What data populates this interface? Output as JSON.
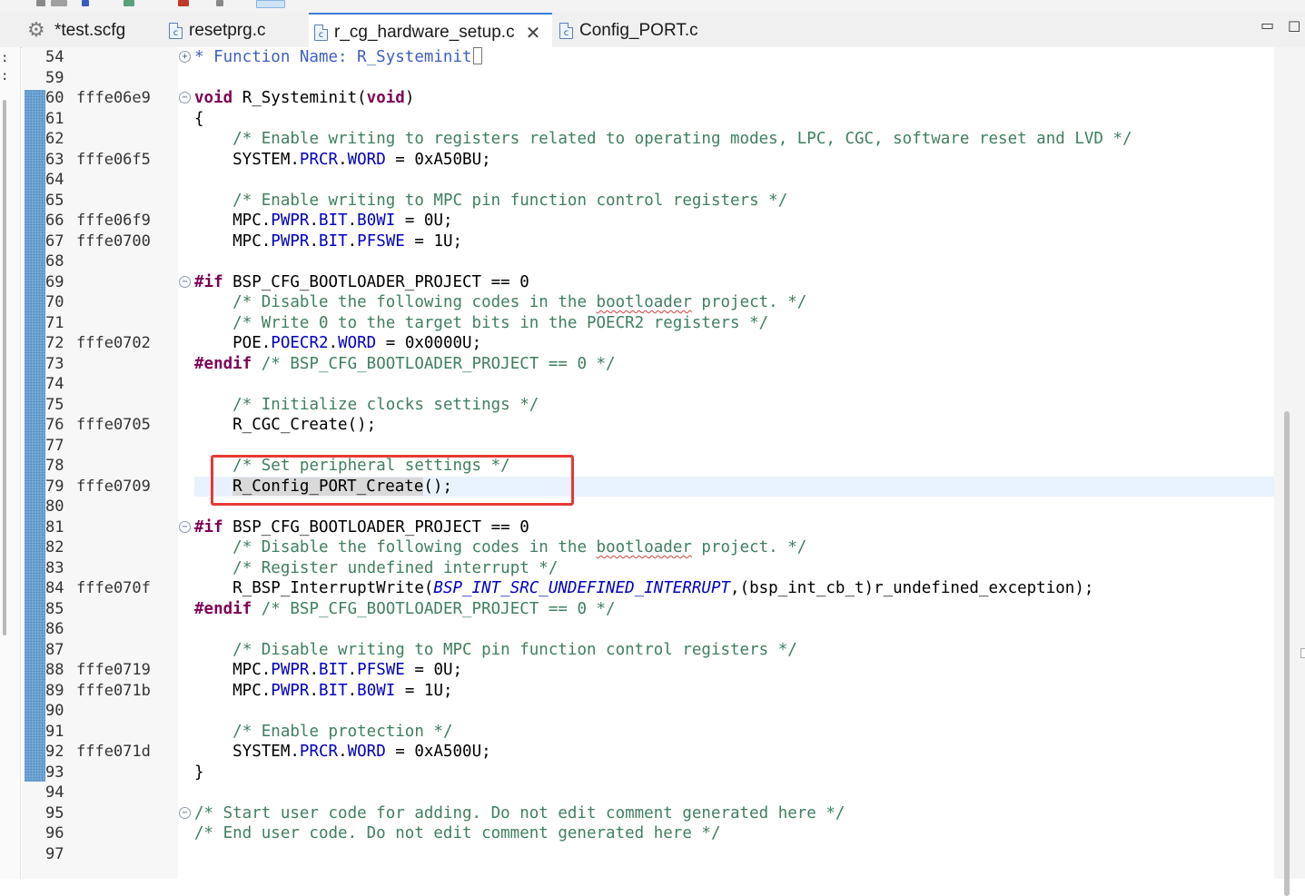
{
  "tabs": [
    {
      "label": "*test.scfg",
      "icon": "gear-icon",
      "active": false
    },
    {
      "label": "resetprg.c",
      "icon": "c-file-icon",
      "active": false
    },
    {
      "label": "r_cg_hardware_setup.c",
      "icon": "c-file-icon",
      "active": true,
      "close": "✕"
    },
    {
      "label": "Config_PORT.c",
      "icon": "c-file-icon",
      "active": false
    }
  ],
  "window_buttons": {
    "minimize": "▭",
    "maximize": "☐"
  },
  "file_icon_letter": "c",
  "colors": {
    "comment": "#3f7f5f",
    "keyword": "#7f0055",
    "field": "#0000c0",
    "current_line": "#e8f2fe",
    "annotation_box": "#e53935",
    "change_bar": "#7fb0dc"
  },
  "lines": [
    {
      "num": "54",
      "addr": "",
      "fold": "+",
      "code": [
        [
          "doc",
          "* Function Name: R_Systeminit"
        ],
        [
          "box",
          ""
        ]
      ]
    },
    {
      "num": "59",
      "addr": "",
      "code": []
    },
    {
      "num": "60",
      "addr": "fffe06e9",
      "fold": "−",
      "code": [
        [
          "kw",
          "void"
        ],
        [
          "plain",
          " R_Systeminit("
        ],
        [
          "kw",
          "void"
        ],
        [
          "plain",
          ")"
        ]
      ]
    },
    {
      "num": "61",
      "addr": "",
      "code": [
        [
          "plain",
          "{"
        ]
      ]
    },
    {
      "num": "62",
      "addr": "",
      "code": [
        [
          "plain",
          "    "
        ],
        [
          "cmt",
          "/* Enable writing to registers related to operating modes, LPC, CGC, software reset and LVD */"
        ]
      ]
    },
    {
      "num": "63",
      "addr": "fffe06f5",
      "code": [
        [
          "plain",
          "    SYSTEM."
        ],
        [
          "fld",
          "PRCR"
        ],
        [
          "plain",
          "."
        ],
        [
          "fld",
          "WORD"
        ],
        [
          "plain",
          " = 0xA50BU;"
        ]
      ]
    },
    {
      "num": "64",
      "addr": "",
      "code": []
    },
    {
      "num": "65",
      "addr": "",
      "code": [
        [
          "plain",
          "    "
        ],
        [
          "cmt",
          "/* Enable writing to MPC pin function control registers */"
        ]
      ]
    },
    {
      "num": "66",
      "addr": "fffe06f9",
      "code": [
        [
          "plain",
          "    MPC."
        ],
        [
          "fld",
          "PWPR"
        ],
        [
          "plain",
          "."
        ],
        [
          "fld",
          "BIT"
        ],
        [
          "plain",
          "."
        ],
        [
          "fld",
          "B0WI"
        ],
        [
          "plain",
          " = 0U;"
        ]
      ]
    },
    {
      "num": "67",
      "addr": "fffe0700",
      "code": [
        [
          "plain",
          "    MPC."
        ],
        [
          "fld",
          "PWPR"
        ],
        [
          "plain",
          "."
        ],
        [
          "fld",
          "BIT"
        ],
        [
          "plain",
          "."
        ],
        [
          "fld",
          "PFSWE"
        ],
        [
          "plain",
          " = 1U;"
        ]
      ]
    },
    {
      "num": "68",
      "addr": "",
      "code": []
    },
    {
      "num": "69",
      "addr": "",
      "fold": "−",
      "code": [
        [
          "pp",
          "#if"
        ],
        [
          "plain",
          " BSP_CFG_BOOTLOADER_PROJECT == 0"
        ]
      ]
    },
    {
      "num": "70",
      "addr": "",
      "code": [
        [
          "plain",
          "    "
        ],
        [
          "cmt",
          "/* Disable the following codes in the "
        ],
        [
          "cmtsq",
          "bootloader"
        ],
        [
          "cmt",
          " project. */"
        ]
      ]
    },
    {
      "num": "71",
      "addr": "",
      "code": [
        [
          "plain",
          "    "
        ],
        [
          "cmt",
          "/* Write 0 to the target bits in the POECR2 registers */"
        ]
      ]
    },
    {
      "num": "72",
      "addr": "fffe0702",
      "code": [
        [
          "plain",
          "    POE."
        ],
        [
          "fld",
          "POECR2"
        ],
        [
          "plain",
          "."
        ],
        [
          "fld",
          "WORD"
        ],
        [
          "plain",
          " = 0x0000U;"
        ]
      ]
    },
    {
      "num": "73",
      "addr": "",
      "code": [
        [
          "pp",
          "#endif"
        ],
        [
          "plain",
          " "
        ],
        [
          "cmt",
          "/* BSP_CFG_BOOTLOADER_PROJECT == 0 */"
        ]
      ]
    },
    {
      "num": "74",
      "addr": "",
      "code": []
    },
    {
      "num": "75",
      "addr": "",
      "code": [
        [
          "plain",
          "    "
        ],
        [
          "cmt",
          "/* Initialize clocks settings */"
        ]
      ]
    },
    {
      "num": "76",
      "addr": "fffe0705",
      "code": [
        [
          "plain",
          "    R_CGC_Create();"
        ]
      ]
    },
    {
      "num": "77",
      "addr": "",
      "code": []
    },
    {
      "num": "78",
      "addr": "",
      "code": [
        [
          "plain",
          "    "
        ],
        [
          "cmt",
          "/* Set peripheral settings */"
        ]
      ]
    },
    {
      "num": "79",
      "addr": "fffe0709",
      "current": true,
      "code": [
        [
          "plain",
          "    "
        ],
        [
          "sel",
          "R_Config_POR"
        ],
        [
          "caret",
          ""
        ],
        [
          "sel",
          "T_Create"
        ],
        [
          "plain",
          "();"
        ]
      ]
    },
    {
      "num": "80",
      "addr": "",
      "code": []
    },
    {
      "num": "81",
      "addr": "",
      "fold": "−",
      "code": [
        [
          "pp",
          "#if"
        ],
        [
          "plain",
          " BSP_CFG_BOOTLOADER_PROJECT == 0"
        ]
      ]
    },
    {
      "num": "82",
      "addr": "",
      "code": [
        [
          "plain",
          "    "
        ],
        [
          "cmt",
          "/* Disable the following codes in the "
        ],
        [
          "cmtsq",
          "bootloader"
        ],
        [
          "cmt",
          " project. */"
        ]
      ]
    },
    {
      "num": "83",
      "addr": "",
      "code": [
        [
          "plain",
          "    "
        ],
        [
          "cmt",
          "/* Register undefined interrupt */"
        ]
      ]
    },
    {
      "num": "84",
      "addr": "fffe070f",
      "code": [
        [
          "plain",
          "    R_BSP_InterruptWrite("
        ],
        [
          "enm",
          "BSP_INT_SRC_UNDEFINED_INTERRUPT"
        ],
        [
          "plain",
          ",(bsp_int_cb_t)r_undefined_exception);"
        ]
      ]
    },
    {
      "num": "85",
      "addr": "",
      "code": [
        [
          "pp",
          "#endif"
        ],
        [
          "plain",
          " "
        ],
        [
          "cmt",
          "/* BSP_CFG_BOOTLOADER_PROJECT == 0 */"
        ]
      ]
    },
    {
      "num": "86",
      "addr": "",
      "code": []
    },
    {
      "num": "87",
      "addr": "",
      "code": [
        [
          "plain",
          "    "
        ],
        [
          "cmt",
          "/* Disable writing to MPC pin function control registers */"
        ]
      ]
    },
    {
      "num": "88",
      "addr": "fffe0719",
      "code": [
        [
          "plain",
          "    MPC."
        ],
        [
          "fld",
          "PWPR"
        ],
        [
          "plain",
          "."
        ],
        [
          "fld",
          "BIT"
        ],
        [
          "plain",
          "."
        ],
        [
          "fld",
          "PFSWE"
        ],
        [
          "plain",
          " = 0U;"
        ]
      ]
    },
    {
      "num": "89",
      "addr": "fffe071b",
      "code": [
        [
          "plain",
          "    MPC."
        ],
        [
          "fld",
          "PWPR"
        ],
        [
          "plain",
          "."
        ],
        [
          "fld",
          "BIT"
        ],
        [
          "plain",
          "."
        ],
        [
          "fld",
          "B0WI"
        ],
        [
          "plain",
          " = 1U;"
        ]
      ]
    },
    {
      "num": "90",
      "addr": "",
      "code": []
    },
    {
      "num": "91",
      "addr": "",
      "code": [
        [
          "plain",
          "    "
        ],
        [
          "cmt",
          "/* Enable protection */"
        ]
      ]
    },
    {
      "num": "92",
      "addr": "fffe071d",
      "code": [
        [
          "plain",
          "    SYSTEM."
        ],
        [
          "fld",
          "PRCR"
        ],
        [
          "plain",
          "."
        ],
        [
          "fld",
          "WORD"
        ],
        [
          "plain",
          " = 0xA500U;"
        ]
      ]
    },
    {
      "num": "93",
      "addr": "",
      "code": [
        [
          "plain",
          "}"
        ]
      ]
    },
    {
      "num": "94",
      "addr": "",
      "code": []
    },
    {
      "num": "95",
      "addr": "",
      "fold": "−",
      "code": [
        [
          "cmt",
          "/* Start user code for adding. Do not edit comment generated here */"
        ]
      ]
    },
    {
      "num": "96",
      "addr": "",
      "code": [
        [
          "cmt",
          "/* End user code. Do not edit comment generated here */"
        ]
      ]
    },
    {
      "num": "97",
      "addr": "",
      "code": []
    }
  ]
}
